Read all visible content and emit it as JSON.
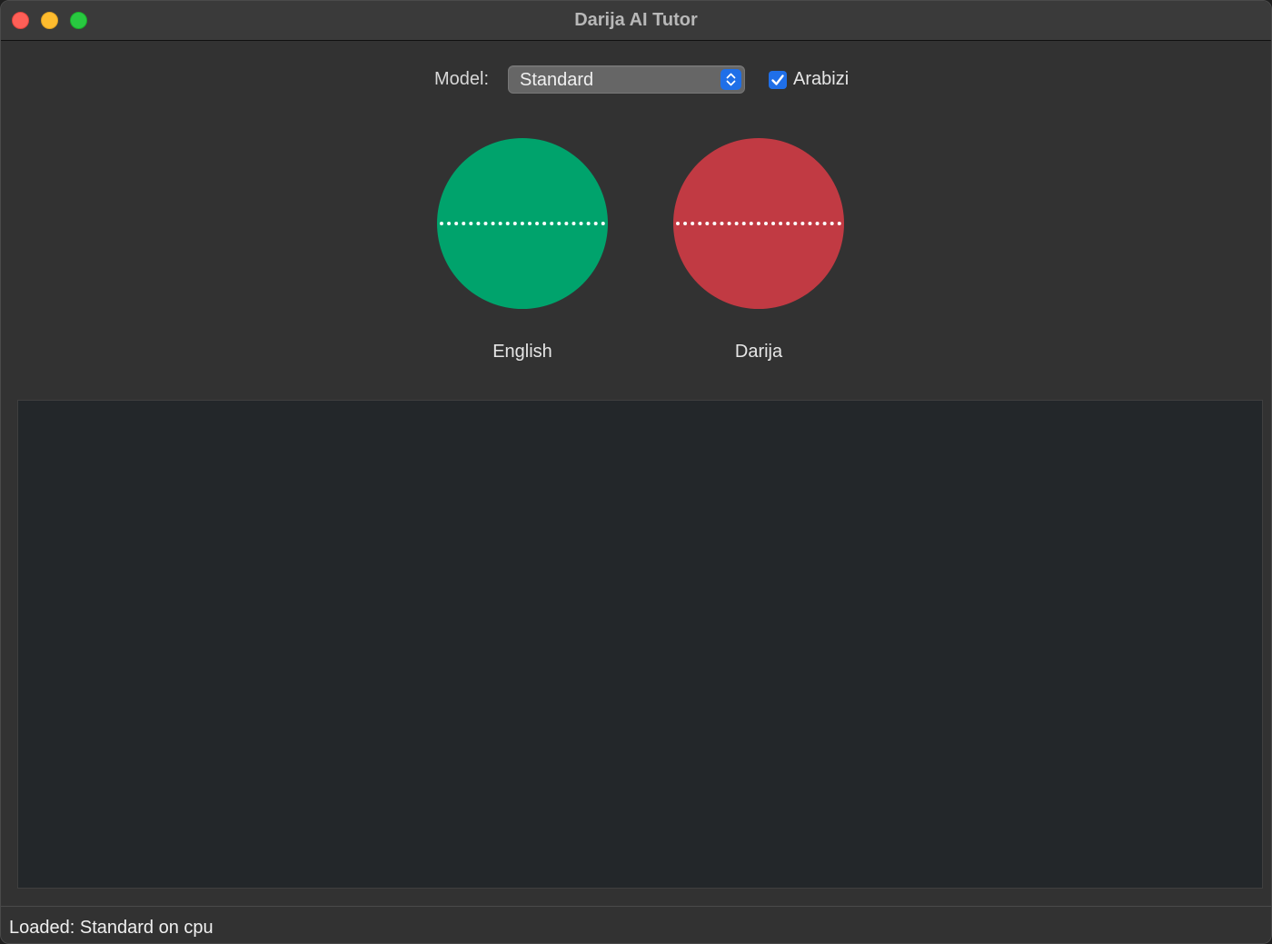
{
  "window": {
    "title": "Darija AI Tutor"
  },
  "controls": {
    "model_label": "Model:",
    "model_select": {
      "selected": "Standard"
    },
    "arabizi": {
      "label": "Arabizi",
      "checked": true
    }
  },
  "languages": [
    {
      "label": "English",
      "color": "#00a36c"
    },
    {
      "label": "Darija",
      "color": "#c13a43"
    }
  ],
  "status": {
    "text": "Loaded: Standard on cpu"
  },
  "colors": {
    "accent": "#1f6fe8",
    "english_orb": "#00a36c",
    "darija_orb": "#c13a43"
  },
  "icons": {
    "stepper": "chevron-up-down-icon",
    "checkbox": "checkmark-icon"
  }
}
